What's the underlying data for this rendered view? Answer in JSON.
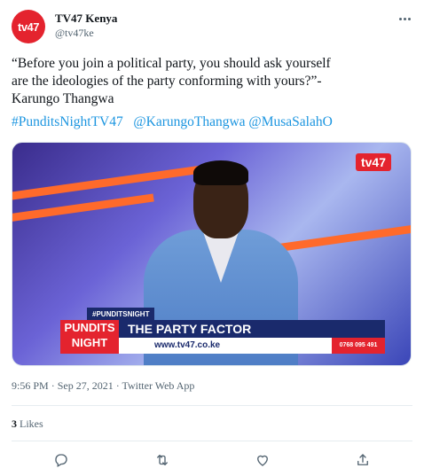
{
  "tweet": {
    "avatar_text": "tv47",
    "display_name": "TV47 Kenya",
    "handle": "@tv47ke",
    "text_lines": [
      "“Before you join a political party, you should ask yourself",
      "are the ideologies of the party conforming with yours?”-",
      "Karungo Thangwa"
    ],
    "hashtags": [
      "#PunditsNightTV47",
      "@KarungoThangwa",
      "@MusaSalahO"
    ],
    "time": "9:56 PM",
    "date": "Sep 27, 2021",
    "source": "Twitter Web App",
    "likes_count": "3",
    "likes_label": "Likes"
  },
  "media": {
    "logo": "tv47",
    "hashtag_banner": "#PUNDITSNIGHT",
    "show_name_line1": "PUNDITS",
    "show_name_line2": "NIGHT",
    "title": "THE PARTY FACTOR",
    "url": "www.tv47.co.ke",
    "phone": "0768 095 491"
  },
  "icons": {
    "more": "more-icon",
    "reply": "reply-icon",
    "retweet": "retweet-icon",
    "like": "like-icon",
    "share": "share-icon"
  },
  "colors": {
    "link": "#1b95e0",
    "brand_red": "#e4232e",
    "muted": "#536471"
  }
}
